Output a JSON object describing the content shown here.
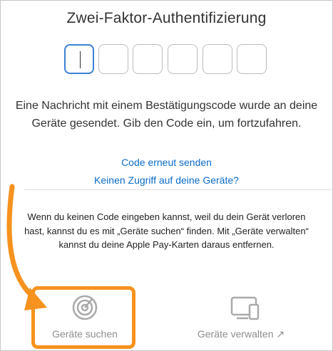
{
  "title": "Zwei-Faktor-Authentifizierung",
  "code_inputs": [
    "",
    "",
    "",
    "",
    "",
    ""
  ],
  "message": "Eine Nachricht mit einem Bestätigungscode wurde an deine Geräte gesendet. Gib den Code ein, um fortzufahren.",
  "links": {
    "resend": "Code erneut senden",
    "no_access": "Keinen Zugriff auf deine Geräte?"
  },
  "info_text": "Wenn du keinen Code eingeben kannst, weil du dein Gerät verloren hast, kannst du es mit „Geräte suchen“ finden. Mit „Geräte verwalten“ kannst du deine Apple Pay-Karten daraus entfernen.",
  "options": {
    "find_devices": {
      "label": "Geräte suchen",
      "icon": "radar-icon"
    },
    "manage_devices": {
      "label": "Geräte verwalten ↗",
      "icon": "devices-icon"
    }
  },
  "colors": {
    "link": "#0a6bc8",
    "highlight": "#f6921e",
    "active_input": "#3b82d6"
  }
}
